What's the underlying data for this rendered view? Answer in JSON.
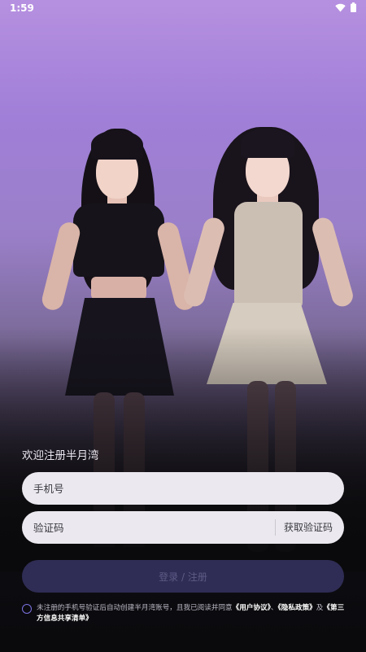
{
  "status_bar": {
    "time": "1:59",
    "icons": [
      "wifi-icon",
      "battery-icon"
    ]
  },
  "hero": {
    "image_subject": "two-people-standing-photo"
  },
  "login": {
    "welcome_text": "欢迎注册半月湾",
    "phone_placeholder": "手机号",
    "code_placeholder": "验证码",
    "get_code_label": "获取验证码",
    "submit_label": "登录 / 注册"
  },
  "agreement": {
    "prefix": "未注册的手机号验证后自动创建半月湾账号，且我已阅读并同意",
    "user_agreement": "《用户协议》",
    "sep1": "、",
    "privacy_policy": "《隐私政策》",
    "sep2": "及",
    "third_party_list": "《第三方信息共享清单》"
  },
  "colors": {
    "background_top": "#b690e0",
    "background_bottom": "#0a0a0c",
    "button_bg": "#2f2d55",
    "radio_accent": "#7a72e0"
  }
}
